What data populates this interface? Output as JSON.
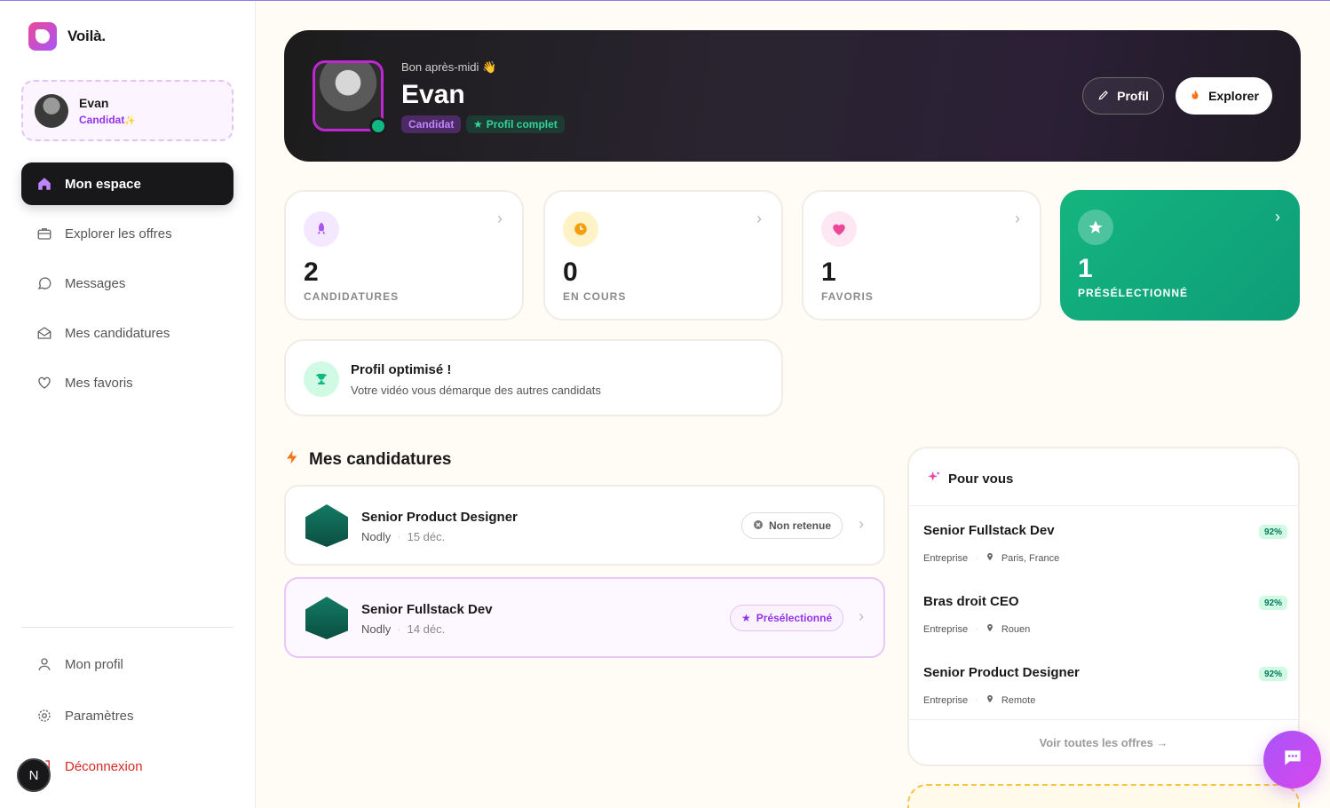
{
  "brand": {
    "name": "Voilà."
  },
  "user": {
    "name": "Evan",
    "role": "Candidat",
    "role_suffix": "✨"
  },
  "nav": {
    "active": "Mon espace",
    "items": [
      "Explorer les offres",
      "Messages",
      "Mes candidatures",
      "Mes favoris"
    ],
    "bottom": [
      "Mon profil",
      "Paramètres",
      "Déconnexion"
    ]
  },
  "corner_badge": "N",
  "hero": {
    "greeting": "Bon après-midi 👋",
    "name": "Evan",
    "chip_role": "Candidat",
    "chip_status": "Profil complet",
    "btn_profil": "Profil",
    "btn_explorer": "Explorer"
  },
  "stats": [
    {
      "value": "2",
      "label": "CANDIDATURES",
      "icon": "rocket-icon",
      "color": "#a855f7"
    },
    {
      "value": "0",
      "label": "EN COURS",
      "icon": "clock-icon",
      "color": "#f59e0b"
    },
    {
      "value": "1",
      "label": "FAVORIS",
      "icon": "heart-icon",
      "color": "#ec4899"
    },
    {
      "value": "1",
      "label": "PRÉSÉLECTIONNÉ",
      "icon": "star-icon",
      "color": "#10b981"
    }
  ],
  "optimized": {
    "title": "Profil optimisé !",
    "subtitle": "Votre vidéo vous démarque des autres candidats"
  },
  "applications": {
    "title": "Mes candidatures",
    "items": [
      {
        "title": "Senior Product Designer",
        "company": "Nodly",
        "date": "15 déc.",
        "status": "Non retenue"
      },
      {
        "title": "Senior Fullstack Dev",
        "company": "Nodly",
        "date": "14 déc.",
        "status": "Présélectionné"
      }
    ]
  },
  "for_you": {
    "title": "Pour vous",
    "jobs": [
      {
        "title": "Senior Fullstack Dev",
        "company": "Entreprise",
        "location": "Paris, France",
        "match": "92%"
      },
      {
        "title": "Bras droit CEO",
        "company": "Entreprise",
        "location": "Rouen",
        "match": "92%"
      },
      {
        "title": "Senior Product Designer",
        "company": "Entreprise",
        "location": "Remote",
        "match": "92%"
      }
    ],
    "see_all": "Voir toutes les offres →"
  },
  "colors": {
    "accent": "#a855f7",
    "green": "#10b981",
    "dark": "#18181b",
    "danger": "#dc2626"
  }
}
